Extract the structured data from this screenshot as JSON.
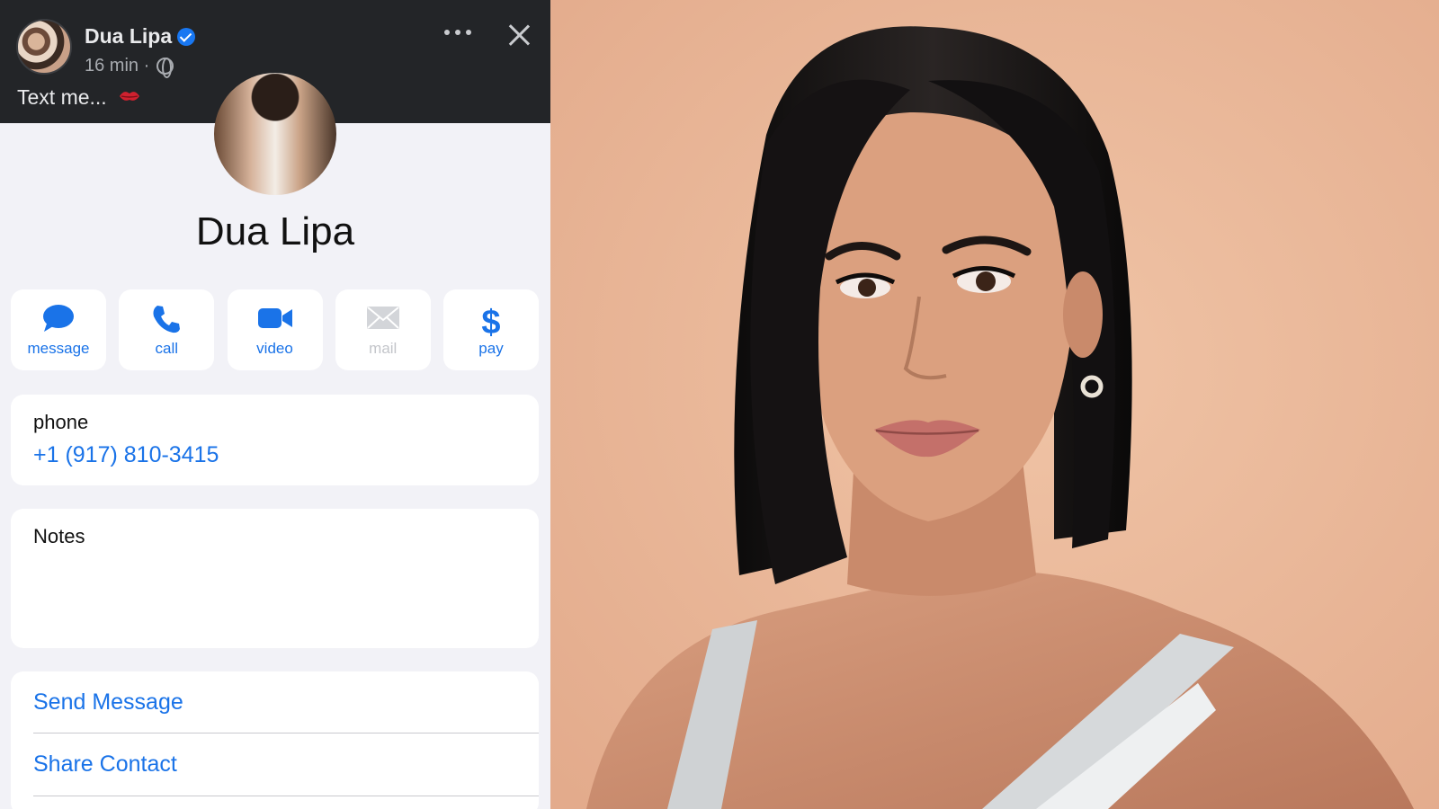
{
  "post": {
    "author": "Dua Lipa",
    "meta": "16 min ·",
    "text": "Text me..."
  },
  "contact": {
    "name": "Dua Lipa",
    "actions": [
      {
        "label": "message",
        "icon": "message-bubble-icon",
        "enabled": true
      },
      {
        "label": "call",
        "icon": "phone-icon",
        "enabled": true
      },
      {
        "label": "video",
        "icon": "video-camera-icon",
        "enabled": true
      },
      {
        "label": "mail",
        "icon": "envelope-icon",
        "enabled": false
      },
      {
        "label": "pay",
        "icon": "dollar-icon",
        "enabled": true
      }
    ],
    "phone_label": "phone",
    "phone_number": "+1 (917) 810-3415",
    "notes_label": "Notes",
    "links": [
      "Send Message",
      "Share Contact"
    ]
  },
  "colors": {
    "accent": "#1a73e8",
    "header_bg": "#232528",
    "panel_bg": "#f2f2f7",
    "photo_bg": "#eab99a"
  }
}
